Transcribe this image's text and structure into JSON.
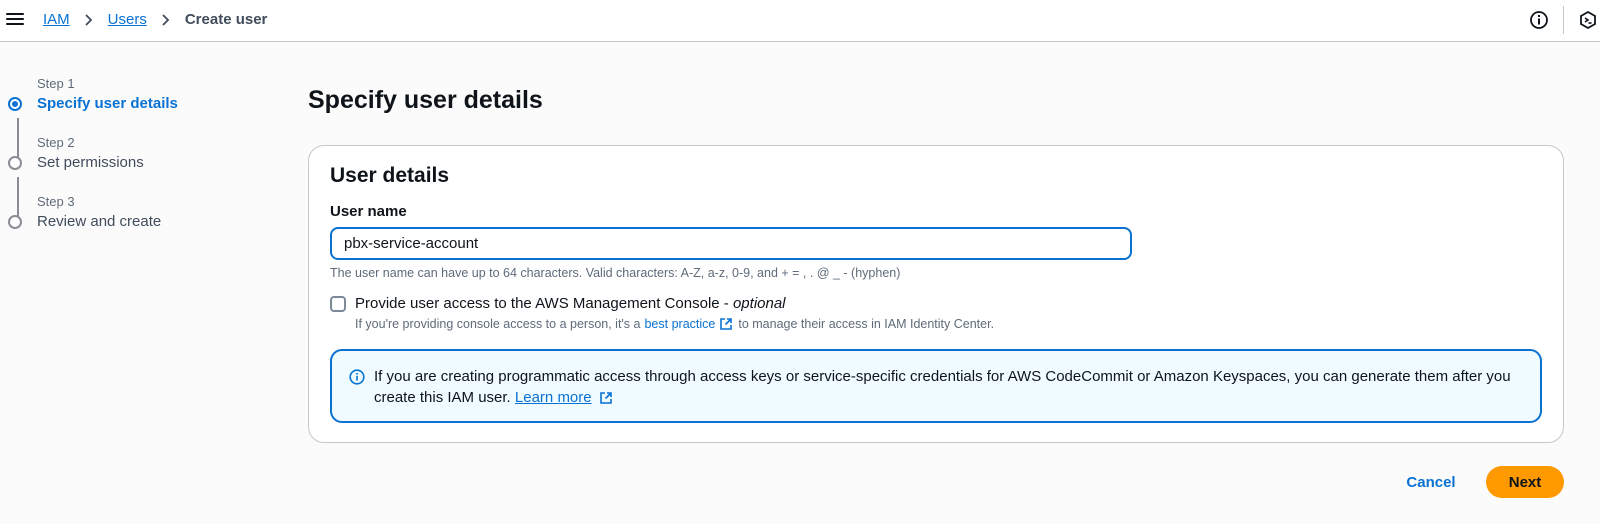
{
  "breadcrumb": {
    "items": [
      "IAM",
      "Users"
    ],
    "current": "Create user"
  },
  "icons": {
    "menu": "hamburger-menu-icon",
    "info": "info-circle-icon",
    "cloudshell": "cloudshell-icon",
    "chevron": "chevron-right-icon",
    "external": "external-link-icon"
  },
  "steps": [
    {
      "number": "Step 1",
      "title": "Specify user details",
      "state": "active"
    },
    {
      "number": "Step 2",
      "title": "Set permissions",
      "state": "inactive"
    },
    {
      "number": "Step 3",
      "title": "Review and create",
      "state": "inactive"
    }
  ],
  "page_title": "Specify user details",
  "user_details": {
    "title": "User details",
    "username_label": "User name",
    "username_value": "pbx-service-account",
    "username_hint": "The user name can have up to 64 characters. Valid characters: A-Z, a-z, 0-9, and + = , . @ _ - (hyphen)",
    "console_label": "Provide user access to the AWS Management Console - ",
    "console_optional": "optional",
    "console_checked": false,
    "console_desc_before": "If you're providing console access to a person, it's a",
    "console_desc_link": "best practice",
    "console_desc_after": "to manage their access in IAM Identity Center."
  },
  "alert": {
    "text": "If you are creating programmatic access through access keys or service-specific credentials for AWS CodeCommit or Amazon Keyspaces, you can generate them after you create this IAM user.",
    "link": "Learn more"
  },
  "actions": {
    "cancel": "Cancel",
    "next": "Next"
  },
  "colors": {
    "accent": "#0972d3",
    "primary_button": "#ff9900",
    "alert_bg": "#f0fbff"
  }
}
